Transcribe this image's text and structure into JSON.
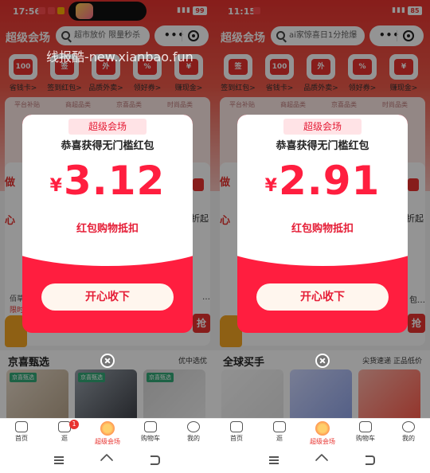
{
  "watermark": "线报酷-new.xianbao.fun",
  "screens": [
    {
      "status": {
        "time": "17:56",
        "battery": "99"
      },
      "header": {
        "title": "超级会场",
        "search_placeholder": "超市放价 限量秒杀"
      },
      "quick_items": [
        {
          "label": "省钱卡>",
          "icon": "100"
        },
        {
          "label": "签到红包>",
          "icon": "签"
        },
        {
          "label": "品质外卖>",
          "icon": "外"
        },
        {
          "label": "领好券>",
          "icon": "%"
        },
        {
          "label": "赚现金>",
          "icon": "¥"
        }
      ],
      "strip_tabs": [
        "平台补贴",
        "商超品类",
        "京喜品类",
        "时尚品类"
      ],
      "bg": {
        "left_text_1": "做",
        "left_text_2": "心",
        "right_text_1": "折起",
        "small_1": "佰草",
        "small_2": "限时",
        "right_small": "…",
        "buy_btn": "抢"
      },
      "dialog": {
        "badge": "超级会场",
        "headline": "恭喜获得无门槛红包",
        "currency": "¥",
        "amount": "3.12",
        "subtitle": "红包购物抵扣",
        "cta": "开心收下"
      },
      "section": {
        "title": "京喜甄选",
        "tag": "优中选优",
        "prod_tag": "京喜甄选"
      },
      "tabbar": [
        {
          "label": "首页"
        },
        {
          "label": "逛",
          "badge": "1"
        },
        {
          "label": "超级会场",
          "active": true
        },
        {
          "label": "购物车"
        },
        {
          "label": "我的"
        }
      ]
    },
    {
      "status": {
        "time": "11:15",
        "battery": "85"
      },
      "header": {
        "title": "超级会场",
        "search_placeholder": "ai家惊喜日1分抢爆"
      },
      "quick_items": [
        {
          "label": "签到红包>",
          "icon": "签"
        },
        {
          "label": "省钱卡>",
          "icon": "100"
        },
        {
          "label": "品质外卖>",
          "icon": "外"
        },
        {
          "label": "领好券>",
          "icon": "%"
        },
        {
          "label": "赚现金>",
          "icon": "¥"
        }
      ],
      "strip_tabs": [
        "平台补贴",
        "商超品类",
        "京喜品类",
        "时尚品类"
      ],
      "bg": {
        "left_text_1": "做",
        "left_text_2": "心",
        "right_text_1": "折起",
        "small_1": "",
        "small_2": "",
        "right_small": "包…",
        "buy_btn": "抢"
      },
      "dialog": {
        "badge": "超级会场",
        "headline": "恭喜获得无门槛红包",
        "currency": "¥",
        "amount": "2.91",
        "subtitle": "红包购物抵扣",
        "cta": "开心收下"
      },
      "section": {
        "title": "全球买手",
        "tag": "尖货速递 正品低价",
        "prod_tag": ""
      },
      "tabbar": [
        {
          "label": "首页"
        },
        {
          "label": "逛"
        },
        {
          "label": "超级会场",
          "active": true
        },
        {
          "label": "购物车"
        },
        {
          "label": "我的"
        }
      ]
    }
  ]
}
